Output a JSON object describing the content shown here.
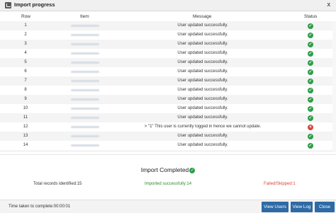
{
  "window": {
    "title": "Import progress",
    "close_label": "x"
  },
  "table": {
    "headers": {
      "row": "Row",
      "item": "Item",
      "message": "Message",
      "status": "Status"
    },
    "rows": [
      {
        "row": "1",
        "message": "User updated successfully.",
        "status": "success"
      },
      {
        "row": "2",
        "message": "User updated successfully.",
        "status": "success"
      },
      {
        "row": "3",
        "message": "User updated successfully.",
        "status": "success"
      },
      {
        "row": "4",
        "message": "User updated successfully.",
        "status": "success"
      },
      {
        "row": "5",
        "message": "User updated successfully.",
        "status": "success"
      },
      {
        "row": "6",
        "message": "User updated successfully.",
        "status": "success"
      },
      {
        "row": "7",
        "message": "User updated successfully.",
        "status": "success"
      },
      {
        "row": "8",
        "message": "User updated successfully.",
        "status": "success"
      },
      {
        "row": "9",
        "message": "User updated successfully.",
        "status": "success"
      },
      {
        "row": "10",
        "message": "User updated successfully.",
        "status": "success"
      },
      {
        "row": "11",
        "message": "User updated successfully.",
        "status": "success"
      },
      {
        "row": "12",
        "message": "> \"1\" This user is currently logged in hence we cannot update.",
        "status": "failed"
      },
      {
        "row": "13",
        "message": "User updated successfully.",
        "status": "success"
      },
      {
        "row": "14",
        "message": "User updated successfully.",
        "status": "success"
      },
      {
        "row": "",
        "message": "",
        "status": "success"
      }
    ]
  },
  "summary": {
    "title": "Import Completed",
    "total": "Total records identified:15",
    "imported": "Imported successfully:14",
    "failed": "Failed/Skipped:1"
  },
  "footer": {
    "time": "Time taken to complete:00:00:01",
    "view_users": "View Users",
    "view_log": "View Log",
    "close": "Close"
  },
  "colors": {
    "success": "#2e9d4a",
    "failed": "#d9443c",
    "button": "#2d6aa6"
  }
}
